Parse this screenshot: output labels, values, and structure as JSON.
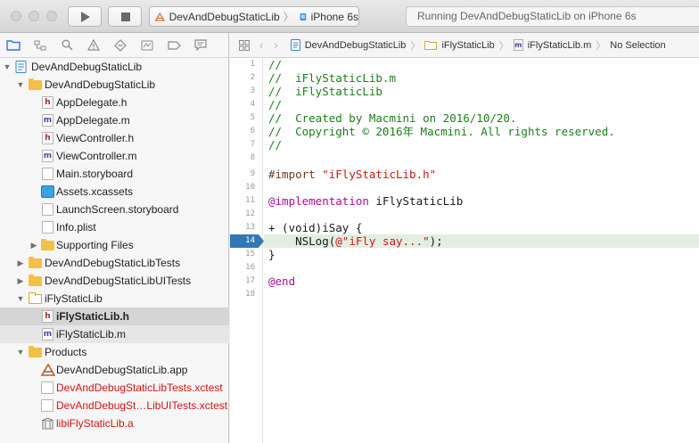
{
  "toolbar": {
    "scheme_project": "DevAndDebugStaticLib",
    "scheme_separator": "〉",
    "scheme_device": "iPhone 6s",
    "activity_status": "Running DevAndDebugStaticLib on iPhone 6s"
  },
  "navigator": {
    "items": [
      {
        "label": "DevAndDebugStaticLib"
      },
      {
        "label": "DevAndDebugStaticLib"
      },
      {
        "label": "AppDelegate.h"
      },
      {
        "label": "AppDelegate.m"
      },
      {
        "label": "ViewController.h"
      },
      {
        "label": "ViewController.m"
      },
      {
        "label": "Main.storyboard"
      },
      {
        "label": "Assets.xcassets"
      },
      {
        "label": "LaunchScreen.storyboard"
      },
      {
        "label": "Info.plist"
      },
      {
        "label": "Supporting Files"
      },
      {
        "label": "DevAndDebugStaticLibTests"
      },
      {
        "label": "DevAndDebugStaticLibUITests"
      },
      {
        "label": "iFlyStaticLib"
      },
      {
        "label": "iFlyStaticLib.h"
      },
      {
        "label": "iFlyStaticLib.m"
      },
      {
        "label": "Products"
      },
      {
        "label": "DevAndDebugStaticLib.app"
      },
      {
        "label": "DevAndDebugStaticLibTests.xctest"
      },
      {
        "label": "DevAndDebugSt…LibUITests.xctest"
      },
      {
        "label": "libiFlyStaticLib.a"
      }
    ]
  },
  "jumpbar": {
    "path": [
      "DevAndDebugStaticLib",
      "iFlyStaticLib",
      "iFlyStaticLib.m",
      "No Selection"
    ],
    "separator": "〉"
  },
  "editor": {
    "current_line": 14,
    "line_numbers": [
      "1",
      "2",
      "3",
      "4",
      "5",
      "6",
      "7",
      "8",
      "9",
      "10",
      "11",
      "12",
      "13",
      "14",
      "15",
      "16",
      "17",
      "18"
    ],
    "lines": {
      "l1": "//",
      "l2": "//  iFlyStaticLib.m",
      "l3": "//  iFlyStaticLib",
      "l4": "//",
      "l5": "//  Created by Macmini on 2016/10/20.",
      "l6": "//  Copyright © 2016年 Macmini. All rights reserved.",
      "l7": "//",
      "l9_directive": "#import ",
      "l9_string": "\"iFlyStaticLib.h\"",
      "l11_keyword": "@implementation",
      "l11_rest": " iFlyStaticLib",
      "l13": "+ (void)iSay {",
      "l14_pre": "    NSLog(",
      "l14_string": "@\"iFly say...\"",
      "l14_post": ");",
      "l15": "}",
      "l17_keyword": "@end"
    }
  },
  "colors": {
    "comment": "#1d7d1d",
    "string": "#c41a16",
    "keyword": "#aa0d91",
    "preprocessor": "#6c3a20",
    "current_line_marker": "#3278b4",
    "error_red": "#d21414",
    "folder": "#f3c047"
  }
}
